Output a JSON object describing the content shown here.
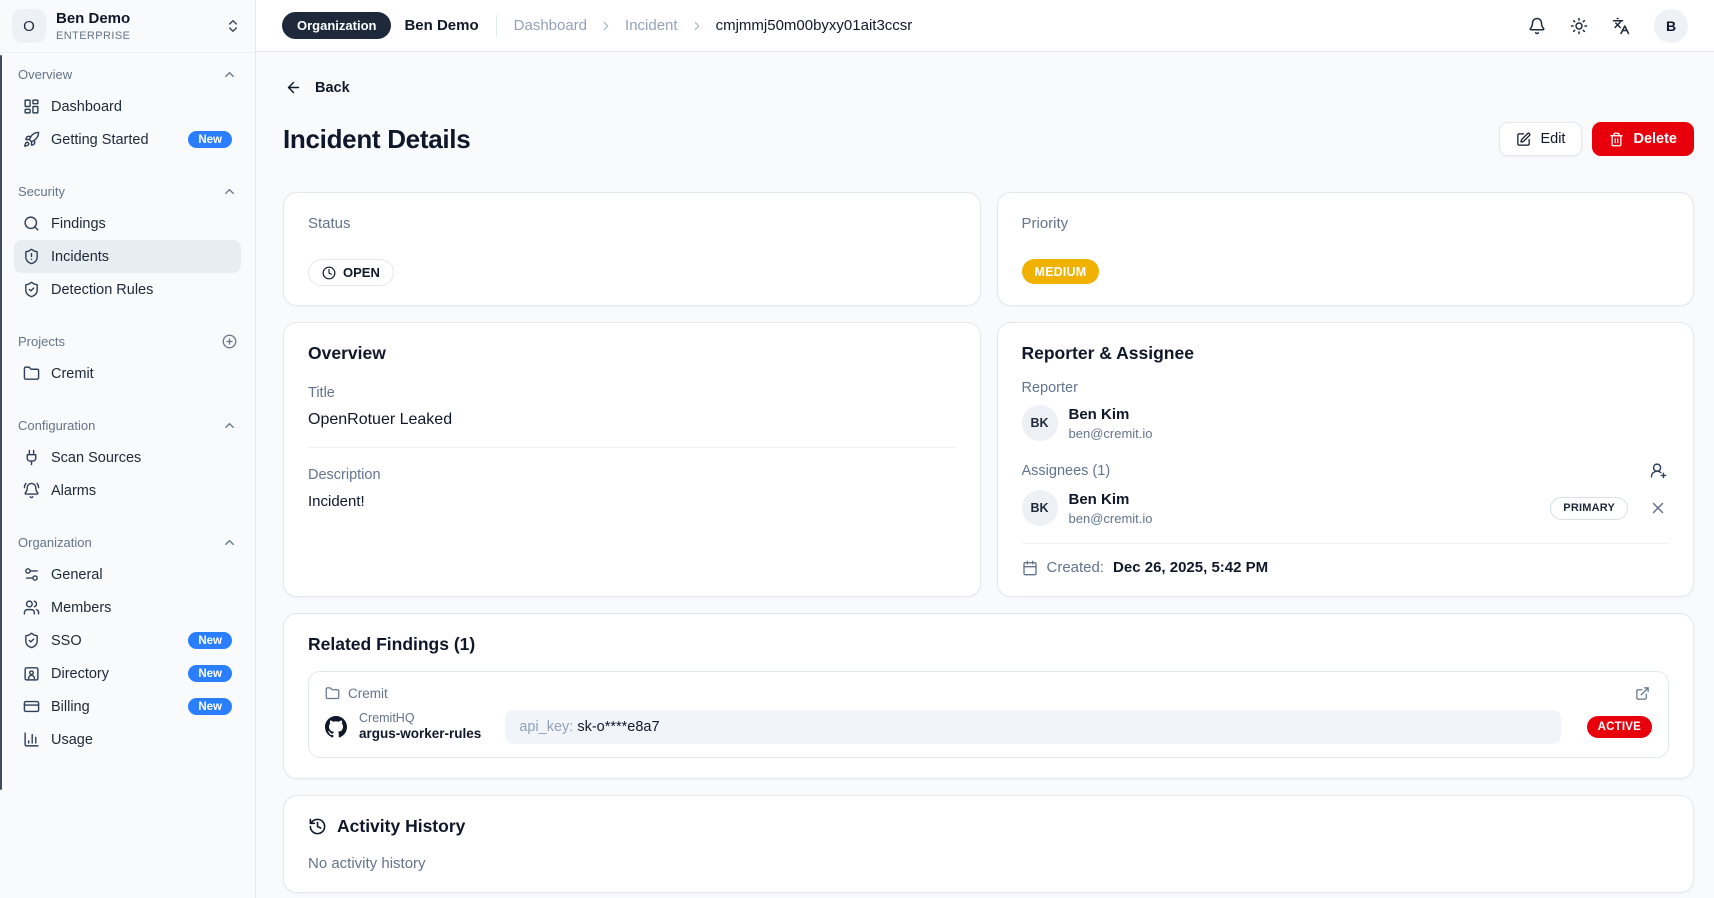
{
  "sidebar": {
    "org": {
      "initial": "O",
      "name": "Ben Demo",
      "plan": "ENTERPRISE"
    },
    "sections": [
      {
        "label": "Overview",
        "action": "collapse",
        "items": [
          {
            "label": "Dashboard",
            "icon": "dashboard"
          },
          {
            "label": "Getting Started",
            "icon": "rocket",
            "badge": "New"
          }
        ]
      },
      {
        "label": "Security",
        "action": "collapse",
        "items": [
          {
            "label": "Findings",
            "icon": "search"
          },
          {
            "label": "Incidents",
            "icon": "shield-alert",
            "active": true
          },
          {
            "label": "Detection Rules",
            "icon": "shield-check"
          }
        ]
      },
      {
        "label": "Projects",
        "action": "add",
        "items": [
          {
            "label": "Cremit",
            "icon": "folder"
          }
        ]
      },
      {
        "label": "Configuration",
        "action": "collapse",
        "items": [
          {
            "label": "Scan Sources",
            "icon": "plug"
          },
          {
            "label": "Alarms",
            "icon": "bell-ring"
          }
        ]
      },
      {
        "label": "Organization",
        "action": "collapse",
        "items": [
          {
            "label": "General",
            "icon": "sliders"
          },
          {
            "label": "Members",
            "icon": "users"
          },
          {
            "label": "SSO",
            "icon": "shield-check",
            "badge": "New"
          },
          {
            "label": "Directory",
            "icon": "contact",
            "badge": "New"
          },
          {
            "label": "Billing",
            "icon": "credit-card",
            "badge": "New"
          },
          {
            "label": "Usage",
            "icon": "chart-column"
          }
        ]
      }
    ]
  },
  "topbar": {
    "scope_badge": "Organization",
    "org_name": "Ben Demo",
    "breadcrumb": [
      "Dashboard",
      "Incident",
      "cmjmmj50m00byxy01ait3ccsr"
    ],
    "avatar_initial": "B"
  },
  "page": {
    "back_label": "Back",
    "title": "Incident Details",
    "edit_label": "Edit",
    "delete_label": "Delete"
  },
  "status_card": {
    "label": "Status",
    "value": "OPEN"
  },
  "priority_card": {
    "label": "Priority",
    "value": "MEDIUM"
  },
  "overview_card": {
    "title": "Overview",
    "title_label": "Title",
    "title_value": "OpenRotuer Leaked",
    "description_label": "Description",
    "description_value": "Incident!"
  },
  "people_card": {
    "title": "Reporter & Assignee",
    "reporter_label": "Reporter",
    "reporter": {
      "initials": "BK",
      "name": "Ben Kim",
      "email": "ben@cremit.io"
    },
    "assignees_label": "Assignees (1)",
    "assignee": {
      "initials": "BK",
      "name": "Ben Kim",
      "email": "ben@cremit.io",
      "badge": "PRIMARY"
    },
    "created_label": "Created:",
    "created_value": "Dec 26, 2025, 5:42 PM"
  },
  "findings_card": {
    "title": "Related Findings (1)",
    "finding": {
      "project": "Cremit",
      "source": "CremitHQ",
      "repo": "argus-worker-rules",
      "secret_label": "api_key:",
      "secret_value": "sk-o****e8a7",
      "status": "ACTIVE"
    }
  },
  "activity_card": {
    "title": "Activity History",
    "empty": "No activity history"
  },
  "colors": {
    "accent_blue": "#2b7fff",
    "danger_red": "#e7000b",
    "warning_amber": "#f0b100",
    "dark_pill": "#1e293b",
    "surface": "#ffffff",
    "page_bg": "#f8fafc",
    "border": "#e2e8f0"
  }
}
